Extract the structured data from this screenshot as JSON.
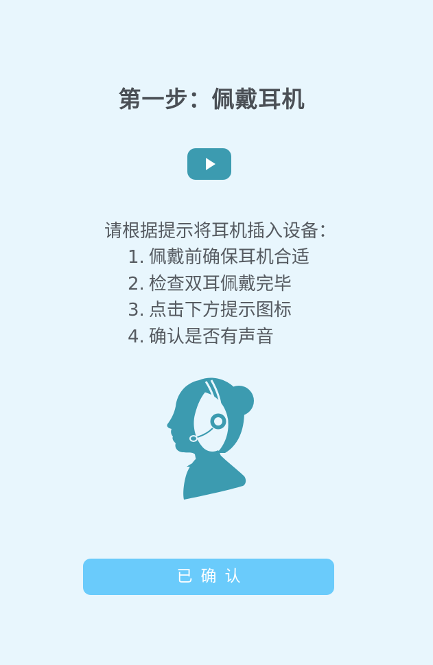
{
  "header": {
    "title": "第一步：佩戴耳机"
  },
  "video": {
    "icon": "play-icon"
  },
  "instructions": {
    "intro": "请根据提示将耳机插入设备：",
    "steps": [
      {
        "num": "1.",
        "text": "佩戴前确保耳机合适"
      },
      {
        "num": "2.",
        "text": "检查双耳佩戴完毕"
      },
      {
        "num": "3.",
        "text": "点击下方提示图标"
      },
      {
        "num": "4.",
        "text": "确认是否有声音"
      }
    ]
  },
  "illustration": {
    "icon": "headset-person-icon"
  },
  "footer": {
    "confirm_label": "已确认"
  },
  "colors": {
    "background": "#e8f6fd",
    "accent": "#3c9bb0",
    "button": "#6acbfb",
    "text": "#555a60"
  }
}
